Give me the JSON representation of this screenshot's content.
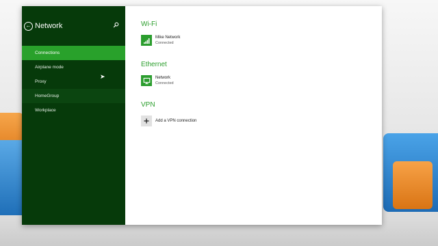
{
  "sidebar": {
    "title": "Network",
    "items": [
      {
        "label": "Connections"
      },
      {
        "label": "Airplane mode"
      },
      {
        "label": "Proxy"
      },
      {
        "label": "HomeGroup"
      },
      {
        "label": "Workplace"
      }
    ]
  },
  "main": {
    "wifi": {
      "title": "Wi-Fi",
      "network": "Mike Network",
      "status": "Connected"
    },
    "ethernet": {
      "title": "Ethernet",
      "network": "Network",
      "status": "Connected"
    },
    "vpn": {
      "title": "VPN",
      "add_label": "Add a VPN connection"
    }
  },
  "colors": {
    "sidebar_bg": "#063a0a",
    "accent": "#29a12b",
    "section_title": "#2a9d2b"
  }
}
